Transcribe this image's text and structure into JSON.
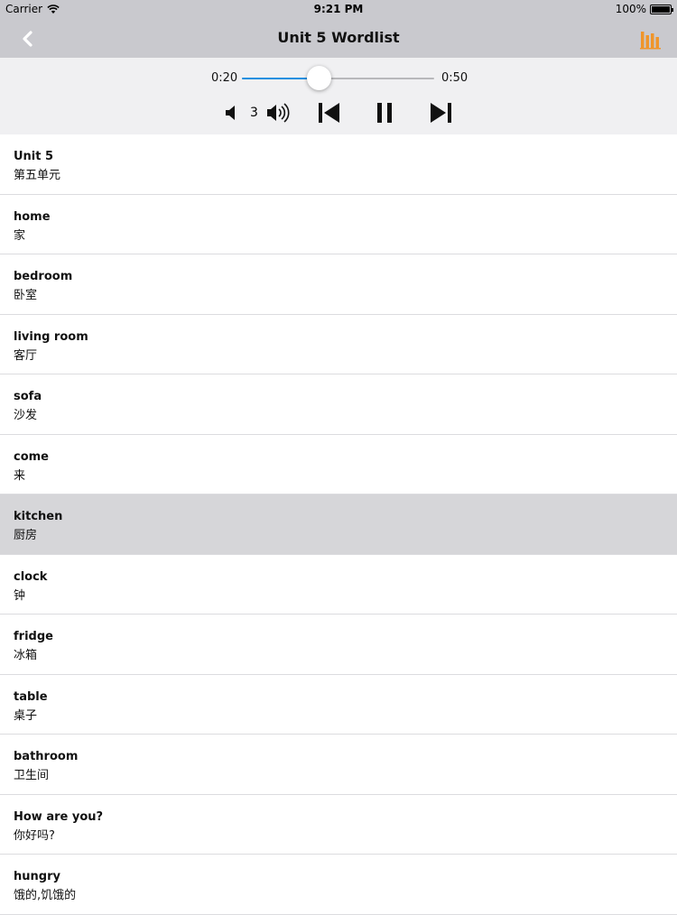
{
  "status": {
    "carrier": "Carrier",
    "time": "9:21 PM",
    "battery": "100%"
  },
  "nav": {
    "title": "Unit 5 Wordlist",
    "accent_color": "#f0952a"
  },
  "player": {
    "current_time": "0:20",
    "total_time": "0:50",
    "progress": 0.4,
    "volume": "3",
    "slider_color": "#1a8fe0"
  },
  "words": [
    {
      "en": "Unit 5",
      "zh": "第五单元"
    },
    {
      "en": "home",
      "zh": "家"
    },
    {
      "en": "bedroom",
      "zh": "卧室"
    },
    {
      "en": "living room",
      "zh": "客厅"
    },
    {
      "en": "sofa",
      "zh": "沙发"
    },
    {
      "en": "come",
      "zh": "来"
    },
    {
      "en": "kitchen",
      "zh": "厨房"
    },
    {
      "en": "clock",
      "zh": "钟"
    },
    {
      "en": "fridge",
      "zh": "冰箱"
    },
    {
      "en": "table",
      "zh": "桌子"
    },
    {
      "en": "bathroom",
      "zh": "卫生间"
    },
    {
      "en": "How are you?",
      "zh": "你好吗?"
    },
    {
      "en": "hungry",
      "zh": "饿的,饥饿的"
    }
  ],
  "selected_index": 6
}
